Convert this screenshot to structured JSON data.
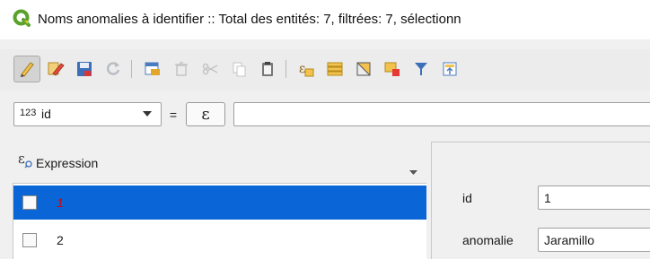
{
  "window": {
    "title": "Noms anomalies à identifier :: Total des entités: 7, filtrées: 7, sélectionn"
  },
  "toolbar": {
    "buttons": [
      {
        "name": "toggle-editing",
        "icon": "pencil-icon"
      },
      {
        "name": "multi-edit",
        "icon": "multi-edit-pencil-icon"
      },
      {
        "name": "save-edits",
        "icon": "save-icon"
      },
      {
        "name": "reload",
        "icon": "refresh-icon"
      },
      {
        "name": "add-feature",
        "icon": "add-row-icon"
      },
      {
        "name": "delete-selected",
        "icon": "trash-icon"
      },
      {
        "name": "cut",
        "icon": "scissors-icon"
      },
      {
        "name": "copy",
        "icon": "copy-icon"
      },
      {
        "name": "paste",
        "icon": "clipboard-icon"
      },
      {
        "name": "select-by-expression",
        "icon": "expression-select-icon"
      },
      {
        "name": "select-all",
        "icon": "select-all-icon"
      },
      {
        "name": "invert-selection",
        "icon": "invert-selection-icon"
      },
      {
        "name": "deselect-all",
        "icon": "deselect-icon"
      },
      {
        "name": "filter-selection",
        "icon": "funnel-icon"
      },
      {
        "name": "move-selection-top",
        "icon": "move-to-top-icon"
      }
    ]
  },
  "filter": {
    "field_type": "123",
    "field_name": "id",
    "operator": "=",
    "expression_symbol": "ε",
    "value": ""
  },
  "list": {
    "header_label": "Expression",
    "rows": [
      {
        "label": "1",
        "selected": true
      },
      {
        "label": "2",
        "selected": false
      }
    ]
  },
  "form": {
    "fields": [
      {
        "label": "id",
        "value": "1"
      },
      {
        "label": "anomalie",
        "value": "Jaramillo"
      }
    ]
  },
  "colors": {
    "selection": "#0a66d6",
    "selected_text": "#d50000",
    "qgis_green": "#5aa22c"
  }
}
